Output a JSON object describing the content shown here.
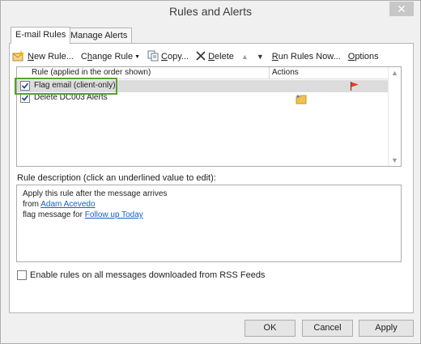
{
  "window": {
    "title": "Rules and Alerts",
    "close_glyph": "✕"
  },
  "tabs": [
    {
      "label": "E-mail Rules",
      "active": true
    },
    {
      "label": "Manage Alerts",
      "active": false
    }
  ],
  "toolbar": {
    "new_rule": {
      "accel": "N",
      "rest": "ew Rule..."
    },
    "change_rule": {
      "pre": "C",
      "accel": "h",
      "rest": "ange Rule"
    },
    "copy": {
      "accel": "C",
      "rest": "opy..."
    },
    "delete": {
      "accel": "D",
      "rest": "elete"
    },
    "run_rules": {
      "accel": "R",
      "rest": "un Rules Now..."
    },
    "options": {
      "accel": "O",
      "rest": "ptions"
    }
  },
  "rules_list": {
    "columns": {
      "rule": "Rule (applied in the order shown)",
      "actions": "Actions"
    },
    "rows": [
      {
        "label": "Flag email  (client-only)",
        "checked": true,
        "selected": true,
        "action_icon": "red-flag-icon"
      },
      {
        "label": "Delete DC003 Alerts",
        "checked": true,
        "selected": false,
        "action_icon": "move-to-folder-icon"
      }
    ]
  },
  "description": {
    "label": "Rule description (click an underlined value to edit):",
    "line1": "Apply this rule after the message arrives",
    "line2_prefix": "from ",
    "line2_link": "Adam Acevedo",
    "line3_prefix": "flag message for ",
    "line3_link": "Follow up Today"
  },
  "rss_option": {
    "label": "Enable rules on all messages downloaded from RSS Feeds",
    "checked": false
  },
  "buttons": {
    "ok": "OK",
    "cancel": "Cancel",
    "apply": "Apply"
  },
  "colors": {
    "highlight": "#5aa02c",
    "link": "#1a5ec1",
    "flag": "#e0401c",
    "folder": "#f2c14e"
  }
}
